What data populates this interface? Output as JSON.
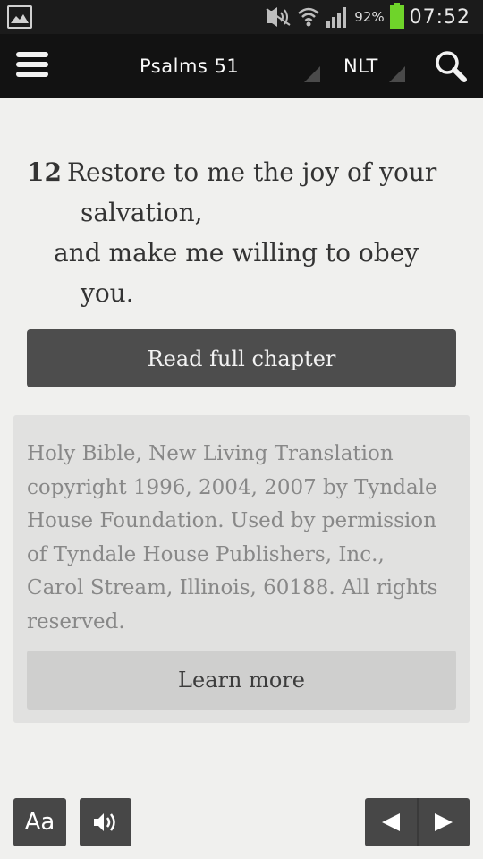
{
  "status_bar": {
    "battery_percent": "92%",
    "time": "07:52",
    "icons": [
      "gallery-icon",
      "mute-icon",
      "wifi-icon",
      "signal-icon",
      "battery-icon"
    ]
  },
  "toolbar": {
    "book": "Psalms 51",
    "version": "NLT",
    "icons": [
      "menu-icon",
      "search-icon"
    ]
  },
  "verse": {
    "number": "12",
    "lines": [
      "Restore to me the joy of your",
      "salvation,",
      "and make me willing to obey",
      "you."
    ]
  },
  "read_full_chapter_label": "Read full chapter",
  "copyright": {
    "lines": [
      "Holy Bible, New Living Translation",
      "copyright 1996, 2004, 2007 by Tyndale",
      "House Foundation. Used by permission",
      "of Tyndale House Publishers, Inc.,",
      "Carol Stream, Illinois, 60188. All rights",
      "reserved."
    ],
    "learn_more_label": "Learn more"
  },
  "bottom_bar": {
    "font_size_label": "Aa",
    "icons": [
      "speaker-icon",
      "previous-arrow-icon",
      "next-arrow-icon"
    ]
  }
}
